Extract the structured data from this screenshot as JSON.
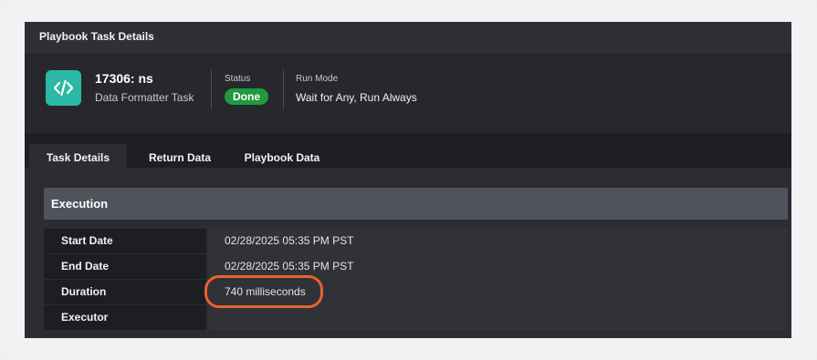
{
  "window": {
    "title": "Playbook Task Details"
  },
  "task": {
    "id": "17306: ns",
    "type": "Data Formatter Task",
    "icon": "code-icon",
    "status_label": "Status",
    "status_value": "Done",
    "run_mode_label": "Run Mode",
    "run_mode_value": "Wait for Any, Run Always"
  },
  "tabs": [
    {
      "label": "Task Details",
      "active": true
    },
    {
      "label": "Return Data",
      "active": false
    },
    {
      "label": "Playbook Data",
      "active": false
    }
  ],
  "execution": {
    "title": "Execution",
    "rows": [
      {
        "label": "Start Date",
        "value": "02/28/2025 05:35 PM PST"
      },
      {
        "label": "End Date",
        "value": "02/28/2025 05:35 PM PST"
      },
      {
        "label": "Duration",
        "value": "740 milliseconds"
      },
      {
        "label": "Executor",
        "value": ""
      }
    ]
  },
  "colors": {
    "accent_icon": "#2cb9a5",
    "status_done": "#1f9a3e",
    "highlight": "#e8632f"
  }
}
